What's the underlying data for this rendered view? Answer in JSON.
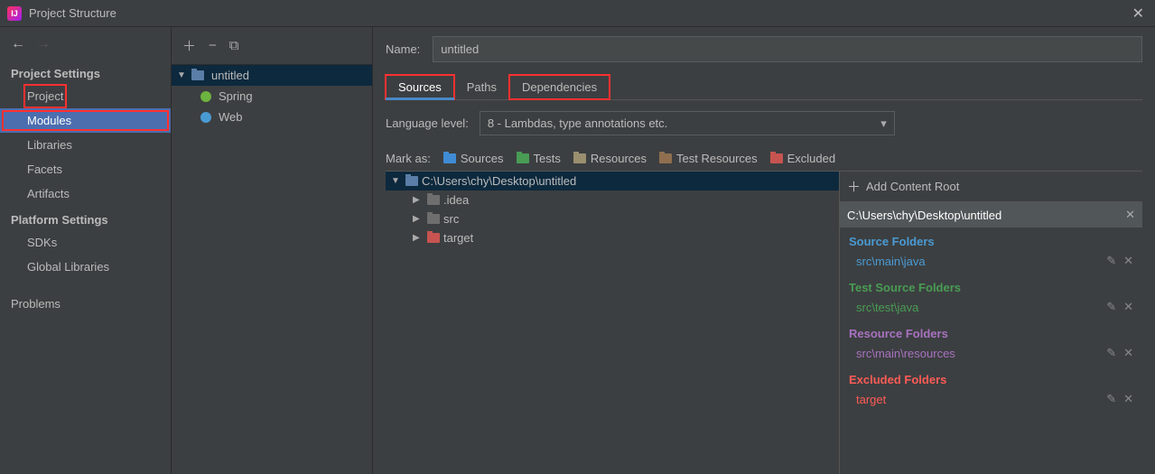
{
  "window": {
    "title": "Project Structure"
  },
  "leftnav": {
    "section1": "Project Settings",
    "items1": [
      "Project",
      "Modules",
      "Libraries",
      "Facets",
      "Artifacts"
    ],
    "section2": "Platform Settings",
    "items2": [
      "SDKs",
      "Global Libraries"
    ],
    "problems": "Problems"
  },
  "midtree": {
    "root": "untitled",
    "children": [
      "Spring",
      "Web"
    ]
  },
  "main": {
    "name_label": "Name:",
    "name_value": "untitled",
    "tabs": [
      "Sources",
      "Paths",
      "Dependencies"
    ],
    "lang_label": "Language level:",
    "lang_value": "8 - Lambdas, type annotations etc.",
    "mark_label": "Mark as:",
    "mark_buttons": [
      "Sources",
      "Tests",
      "Resources",
      "Test Resources",
      "Excluded"
    ],
    "tree_root": "C:\\Users\\chy\\Desktop\\untitled",
    "tree_children": [
      ".idea",
      "src",
      "target"
    ],
    "add_content_root": "Add Content Root",
    "content_root_path": "C:\\Users\\chy\\Desktop\\untitled",
    "folder_groups": [
      {
        "title": "Source Folders",
        "cls": "fg-sources",
        "items": [
          "src\\main\\java"
        ]
      },
      {
        "title": "Test Source Folders",
        "cls": "fg-tests",
        "items": [
          "src\\test\\java"
        ]
      },
      {
        "title": "Resource Folders",
        "cls": "fg-resources",
        "items": [
          "src\\main\\resources"
        ]
      },
      {
        "title": "Excluded Folders",
        "cls": "fg-excluded",
        "items": [
          "target"
        ]
      }
    ]
  }
}
